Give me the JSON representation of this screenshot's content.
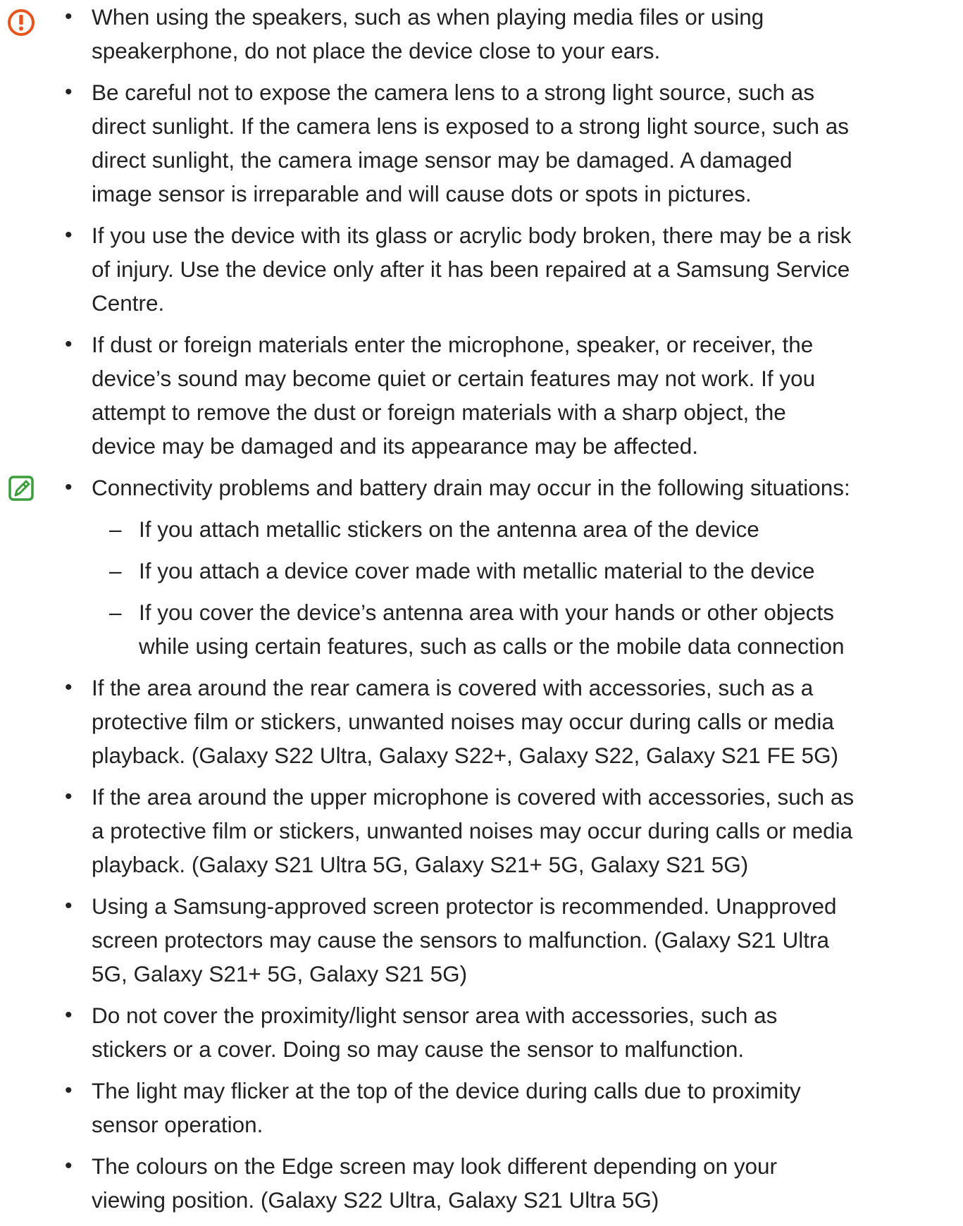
{
  "colors": {
    "caution_icon": "#E8541E",
    "note_icon": "#3A9E3A",
    "text": "#222222"
  },
  "caution": {
    "icon": "caution-icon",
    "items": [
      "When using the speakers, such as when playing media files or using speakerphone, do not place the device close to your ears.",
      "Be careful not to expose the camera lens to a strong light source, such as direct sunlight. If the camera lens is exposed to a strong light source, such as direct sunlight, the camera image sensor may be damaged. A damaged image sensor is irreparable and will cause dots or spots in pictures.",
      "If you use the device with its glass or acrylic body broken, there may be a risk of injury. Use the device only after it has been repaired at a Samsung Service Centre.",
      "If dust or foreign materials enter the microphone, speaker, or receiver, the device’s sound may become quiet or certain features may not work. If you attempt to remove the dust or foreign materials with a sharp object, the device may be damaged and its appearance may be affected."
    ]
  },
  "note": {
    "icon": "note-icon",
    "connectivity": {
      "text": "Connectivity problems and battery drain may occur in the following situations:",
      "sub_items": [
        "If you attach metallic stickers on the antenna area of the device",
        "If you attach a device cover made with metallic material to the device",
        "If you cover the device’s antenna area with your hands or other objects while using certain features, such as calls or the mobile data connection"
      ]
    },
    "items": [
      "If the area around the rear camera is covered with accessories, such as a protective film or stickers, unwanted noises may occur during calls or media playback. (Galaxy S22 Ultra, Galaxy S22+, Galaxy S22, Galaxy S21 FE 5G)",
      "If the area around the upper microphone is covered with accessories, such as a protective film or stickers, unwanted noises may occur during calls or media playback. (Galaxy S21 Ultra 5G, Galaxy S21+ 5G, Galaxy S21 5G)",
      "Using a Samsung-approved screen protector is recommended. Unapproved screen protectors may cause the sensors to malfunction. (Galaxy S21 Ultra 5G, Galaxy S21+ 5G, Galaxy S21 5G)",
      "Do not cover the proximity/light sensor area with accessories, such as stickers or a cover. Doing so may cause the sensor to malfunction.",
      "The light may flicker at the top of the device during calls due to proximity sensor operation.",
      "The colours on the Edge screen may look different depending on your viewing position. (Galaxy S22 Ultra, Galaxy S21 Ultra 5G)"
    ]
  }
}
